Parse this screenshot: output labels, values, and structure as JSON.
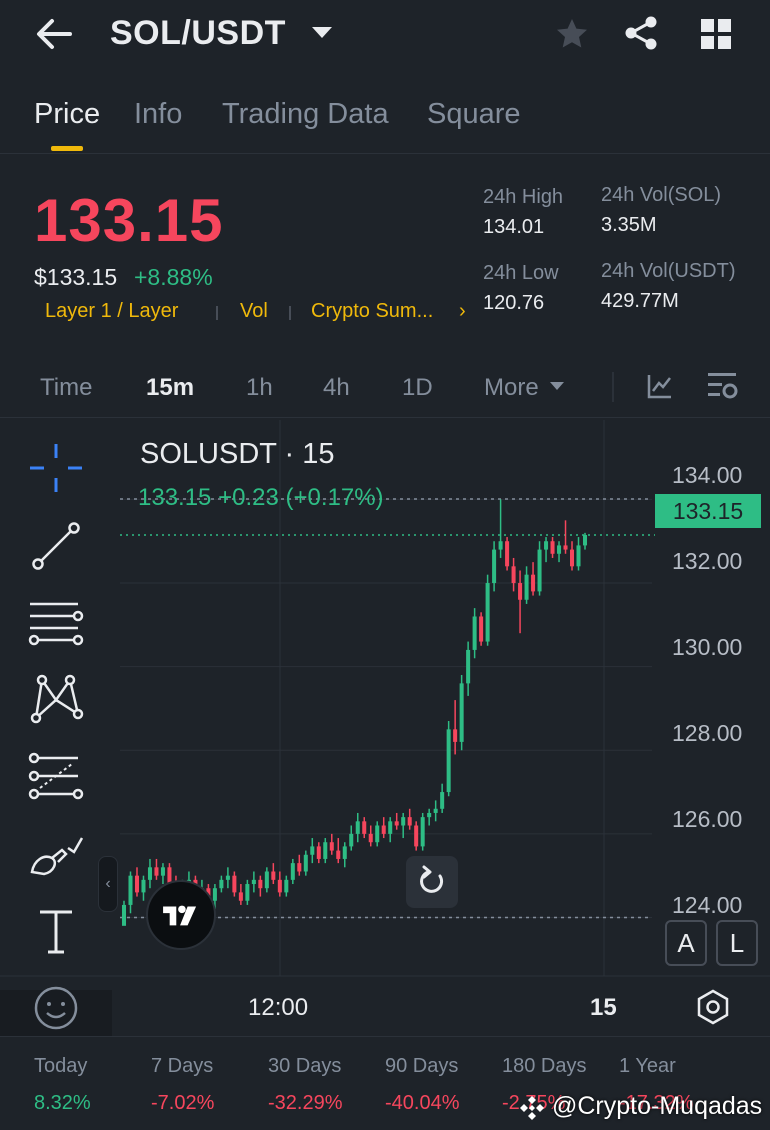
{
  "header": {
    "pair": "SOL/USDT"
  },
  "tabs": [
    {
      "label": "Price",
      "active": true
    },
    {
      "label": "Info",
      "active": false
    },
    {
      "label": "Trading Data",
      "active": false
    },
    {
      "label": "Square",
      "active": false
    }
  ],
  "price": {
    "last": "133.15",
    "usd": "$133.15",
    "change_pct": "+8.88%",
    "tags": [
      "Layer 1 / Layer",
      "Vol",
      "Crypto Sum..."
    ],
    "more_chevron": "›"
  },
  "stats": {
    "high_label": "24h High",
    "high_value": "134.01",
    "low_label": "24h Low",
    "low_value": "120.76",
    "vol_base_label": "24h Vol(SOL)",
    "vol_base_value": "3.35M",
    "vol_quote_label": "24h Vol(USDT)",
    "vol_quote_value": "429.77M"
  },
  "intervals": {
    "items": [
      "Time",
      "15m",
      "1h",
      "4h",
      "1D",
      "More"
    ],
    "active": "15m"
  },
  "chart": {
    "title": "SOLUSDT · 15",
    "legend": "133.15  +0.23 (+0.17%)",
    "last_price_tag": "133.15",
    "y_ticks": [
      "134.00",
      "132.00",
      "130.00",
      "128.00",
      "126.00",
      "124.00"
    ],
    "x_ticks": [
      "12:00",
      "15"
    ],
    "auto_button": "A",
    "log_button": "L",
    "collapse_glyph": "‹"
  },
  "chart_data": {
    "type": "candlestick",
    "symbol": "SOLUSDT",
    "interval": "15",
    "ylim": [
      122.6,
      135.9
    ],
    "y_ticks": [
      134,
      132,
      130,
      128,
      126,
      124
    ],
    "x_tick_labels": [
      "12:00",
      "15"
    ],
    "last_price": 133.15,
    "high_line": 134.01,
    "low_line": 124.0,
    "up_color": "#2ebd85",
    "down_color": "#f6465d",
    "candles": [
      [
        123.8,
        124.4,
        124.0,
        124.3
      ],
      [
        124.3,
        125.1,
        124.1,
        125.0
      ],
      [
        125.0,
        125.2,
        124.5,
        124.6
      ],
      [
        124.6,
        125.0,
        124.4,
        124.9
      ],
      [
        124.9,
        125.4,
        124.7,
        125.2
      ],
      [
        125.2,
        125.4,
        124.9,
        125.0
      ],
      [
        125.0,
        125.3,
        124.8,
        125.2
      ],
      [
        125.2,
        125.3,
        124.7,
        124.8
      ],
      [
        124.8,
        125.0,
        124.4,
        124.5
      ],
      [
        124.5,
        124.9,
        124.3,
        124.8
      ],
      [
        124.8,
        125.1,
        124.6,
        124.9
      ],
      [
        124.9,
        125.0,
        124.5,
        124.6
      ],
      [
        124.6,
        124.9,
        124.4,
        124.7
      ],
      [
        124.7,
        124.8,
        124.3,
        124.4
      ],
      [
        124.4,
        124.8,
        124.2,
        124.7
      ],
      [
        124.7,
        125.0,
        124.6,
        124.9
      ],
      [
        124.9,
        125.2,
        124.7,
        125.0
      ],
      [
        125.0,
        125.1,
        124.5,
        124.6
      ],
      [
        124.6,
        124.8,
        124.3,
        124.4
      ],
      [
        124.4,
        124.9,
        124.3,
        124.8
      ],
      [
        124.8,
        125.1,
        124.6,
        124.9
      ],
      [
        124.9,
        125.0,
        124.5,
        124.7
      ],
      [
        124.7,
        125.2,
        124.6,
        125.1
      ],
      [
        125.1,
        125.3,
        124.8,
        124.9
      ],
      [
        124.9,
        125.1,
        124.5,
        124.6
      ],
      [
        124.6,
        125.0,
        124.5,
        124.9
      ],
      [
        124.9,
        125.4,
        124.8,
        125.3
      ],
      [
        125.3,
        125.5,
        125.0,
        125.1
      ],
      [
        125.1,
        125.6,
        125.0,
        125.5
      ],
      [
        125.5,
        125.9,
        125.3,
        125.7
      ],
      [
        125.7,
        125.8,
        125.3,
        125.4
      ],
      [
        125.4,
        125.9,
        125.3,
        125.8
      ],
      [
        125.8,
        126.0,
        125.5,
        125.6
      ],
      [
        125.6,
        125.9,
        125.3,
        125.4
      ],
      [
        125.4,
        125.8,
        125.2,
        125.7
      ],
      [
        125.7,
        126.2,
        125.6,
        126.0
      ],
      [
        126.0,
        126.5,
        125.8,
        126.3
      ],
      [
        126.3,
        126.4,
        125.9,
        126.0
      ],
      [
        126.0,
        126.2,
        125.7,
        125.8
      ],
      [
        125.8,
        126.3,
        125.7,
        126.2
      ],
      [
        126.2,
        126.4,
        125.9,
        126.0
      ],
      [
        126.0,
        126.4,
        125.8,
        126.3
      ],
      [
        126.3,
        126.5,
        126.1,
        126.2
      ],
      [
        126.2,
        126.5,
        125.9,
        126.4
      ],
      [
        126.4,
        126.6,
        126.1,
        126.2
      ],
      [
        126.2,
        126.3,
        125.6,
        125.7
      ],
      [
        125.7,
        126.5,
        125.6,
        126.4
      ],
      [
        126.4,
        126.6,
        126.2,
        126.5
      ],
      [
        126.5,
        126.8,
        126.3,
        126.6
      ],
      [
        126.6,
        127.2,
        126.5,
        127.0
      ],
      [
        127.0,
        128.7,
        126.9,
        128.5
      ],
      [
        128.5,
        129.2,
        127.9,
        128.2
      ],
      [
        128.2,
        129.8,
        128.0,
        129.6
      ],
      [
        129.6,
        130.6,
        129.3,
        130.4
      ],
      [
        130.4,
        131.4,
        130.2,
        131.2
      ],
      [
        131.2,
        131.3,
        130.5,
        130.6
      ],
      [
        130.6,
        132.2,
        130.5,
        132.0
      ],
      [
        132.0,
        133.0,
        131.8,
        132.8
      ],
      [
        132.8,
        134.0,
        132.6,
        133.0
      ],
      [
        133.0,
        133.1,
        132.3,
        132.4
      ],
      [
        132.4,
        132.6,
        131.8,
        132.0
      ],
      [
        132.0,
        132.3,
        130.8,
        131.6
      ],
      [
        131.6,
        132.4,
        131.5,
        132.2
      ],
      [
        132.2,
        132.5,
        131.7,
        131.8
      ],
      [
        131.8,
        133.0,
        131.7,
        132.8
      ],
      [
        132.8,
        133.1,
        132.5,
        133.0
      ],
      [
        133.0,
        133.1,
        132.6,
        132.7
      ],
      [
        132.7,
        133.0,
        132.5,
        132.9
      ],
      [
        132.9,
        133.5,
        132.7,
        132.8
      ],
      [
        132.8,
        133.0,
        132.3,
        132.4
      ],
      [
        132.4,
        133.1,
        132.3,
        132.9
      ],
      [
        132.9,
        133.2,
        132.8,
        133.15
      ]
    ]
  },
  "performance": [
    {
      "label": "Today",
      "value": "8.32%",
      "dir": "pos"
    },
    {
      "label": "7 Days",
      "value": "-7.02%",
      "dir": "neg"
    },
    {
      "label": "30 Days",
      "value": "-32.29%",
      "dir": "neg"
    },
    {
      "label": "90 Days",
      "value": "-40.04%",
      "dir": "neg"
    },
    {
      "label": "180 Days",
      "value": "-2.75%",
      "dir": "neg"
    },
    {
      "label": "1 Year",
      "value": "-17.32%",
      "dir": "neg"
    }
  ],
  "watermark": "@Crypto-Muqadas",
  "colors": {
    "background": "#1e2329",
    "up": "#2ebd85",
    "down": "#f6465d",
    "accent": "#f0b90b",
    "muted": "#848e9c"
  }
}
